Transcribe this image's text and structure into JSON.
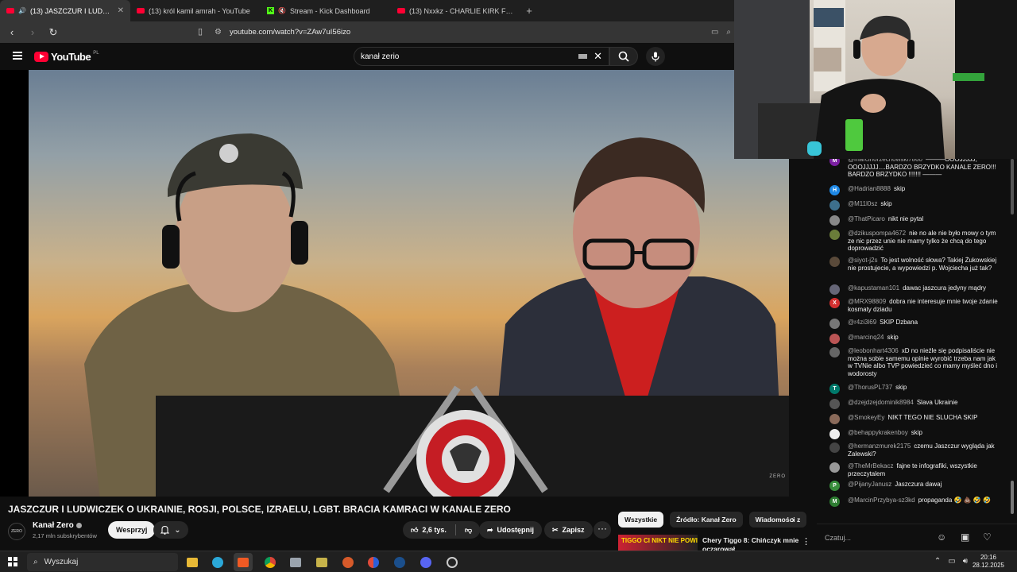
{
  "browser": {
    "tabs": [
      {
        "title": "(13) JASZCZUR I LUDWICZEK",
        "icon": "youtube-icon",
        "active": true
      },
      {
        "title": "(13) król kamil amrah - YouTube",
        "icon": "youtube-icon",
        "active": false
      },
      {
        "title": "Stream - Kick Dashboard",
        "icon": "kick-icon",
        "active": false
      },
      {
        "title": "(13) Nxxkz - CHARLIE KIRK FUNK (OFF...",
        "icon": "youtube-icon",
        "active": false
      }
    ],
    "new_tab": "+",
    "url": "youtube.com/watch?v=ZAw7uI56izo"
  },
  "youtube": {
    "logo_text": "YouTube",
    "logo_region": "PL",
    "search_query": "kanał zerio"
  },
  "video": {
    "title": "JASZCZUR I LUDWICZEK O UKRAINIE, ROSJI, POLSCE, IZRAELU, LGBT. BRACIA KAMRACI W KANALE ZERO",
    "watermark": "ZERO",
    "desk_banner": "TIGGO CI NIKT NIE POWIE"
  },
  "channel": {
    "avatar_text": "ZERO",
    "name": "Kanał Zero",
    "subscribers": "2,17 mln subskrybentów",
    "support_label": "Wesprzyj"
  },
  "actions": {
    "likes": "2,6 tys.",
    "share": "Udostępnij",
    "save": "Zapisz"
  },
  "chips": [
    "Wszystkie",
    "Źródło: Kanał Zero",
    "Wiadomości z"
  ],
  "recommendation": {
    "thumb_text": "TIGGO CI NIKT NIE POWIE",
    "title": "Chery Tiggo 8: Chińczyk mnie oczarował"
  },
  "chat": {
    "messages": [
      {
        "author": "@marcinorzechowski7860",
        "text": "———OOOJJJJJ, OOOJJJJJ....BARDZO BRZYDKO KANALE ZERO!!! BARDZO BRZYDKO !!!!!!! ———",
        "avatar": "M",
        "color": "#7b1fa2"
      },
      {
        "author": "@Hadrian8888",
        "text": "skip",
        "avatar": "H",
        "color": "#1e88e5"
      },
      {
        "author": "@M11l0sz",
        "text": "skip",
        "avatar": "",
        "color": "#3d6f8c"
      },
      {
        "author": "@ThatPicaro",
        "text": "nikt nie pytal",
        "avatar": "",
        "color": "#888"
      },
      {
        "author": "@dzikuspompa4672",
        "text": "nie no ale nie było mowy o tym ze nic przez unie nie mamy tylko że chcą do tego doprowadzić",
        "avatar": "",
        "color": "#6a7d3a"
      },
      {
        "author": "@siyot-j2s",
        "text": "To jest wolność słowa? Takiej Żukowskiej nie prostujecie, a wypowiedzi p. Wojciecha już tak?",
        "avatar": "",
        "color": "#5a4a3a"
      },
      {
        "author": "@kapustaman101",
        "text": "dawac jaszcura jedyny mądry",
        "avatar": "",
        "color": "#667"
      },
      {
        "author": "@MRX98809",
        "text": "dobra nie interesuje mnie twoje zdanie kosmaty dziadu",
        "avatar": "X",
        "color": "#d32f2f"
      },
      {
        "author": "@r4zi3l69",
        "text": "SKIP Dzbana",
        "avatar": "",
        "color": "#777"
      },
      {
        "author": "@marcinq24",
        "text": "skip",
        "avatar": "",
        "color": "#b55"
      },
      {
        "author": "@leobonhart4306",
        "text": "xD no nieźle się podpisaliście nie można sobie samemu opinie wyrobić trzeba nam jak w TVNie albo TVP powiedzieć co mamy myśleć dno i wodorosty",
        "avatar": "",
        "color": "#666"
      },
      {
        "author": "@ThorusPL737",
        "text": "skip",
        "avatar": "T",
        "color": "#00796b"
      },
      {
        "author": "@dzejdzejdominik8984",
        "text": "Slava Ukrainie",
        "avatar": "",
        "color": "#555"
      },
      {
        "author": "@SmokeyEy",
        "text": "NIKT TEGO NIE SLUCHA SKIP",
        "avatar": "",
        "color": "#8a6a5a"
      },
      {
        "author": "@behappykrakenboy",
        "text": "skip",
        "avatar": "",
        "color": "#eee"
      },
      {
        "author": "@hermanzmurek2175",
        "text": "czemu Jaszczur wygląda jak Zalewski?",
        "avatar": "",
        "color": "#444"
      },
      {
        "author": "@TheMrBekacz",
        "text": "fajne te infografiki, wszystkie przeczytalem",
        "avatar": "",
        "color": "#999"
      },
      {
        "author": "@PijanyJanusz",
        "text": "Jaszczura dawaj",
        "avatar": "P",
        "color": "#388e3c"
      },
      {
        "author": "@MarcinPrzybya-sz3kd",
        "text": "propaganda 🤣 💩 🤣 🤣",
        "avatar": "M",
        "color": "#2e7d32"
      }
    ],
    "input_placeholder": "Czatuj..."
  },
  "taskbar": {
    "search_placeholder": "Wyszukaj",
    "time": "20:16",
    "date": "28.12.2025"
  }
}
